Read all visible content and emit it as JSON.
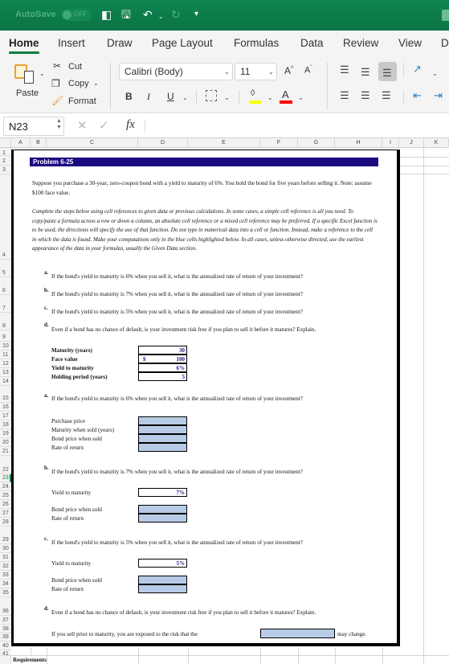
{
  "titlebar": {
    "autosave_label": "AutoSave",
    "autosave_state": "OFF",
    "icons": [
      "sidebar-icon",
      "save-icon",
      "undo-icon",
      "redo-icon",
      "customize-icon"
    ]
  },
  "ribbon": {
    "tabs": [
      {
        "label": "Home",
        "active": true
      },
      {
        "label": "Insert"
      },
      {
        "label": "Draw"
      },
      {
        "label": "Page Layout"
      },
      {
        "label": "Formulas"
      },
      {
        "label": "Data"
      },
      {
        "label": "Review"
      },
      {
        "label": "View"
      },
      {
        "label": "D"
      }
    ],
    "clipboard": {
      "paste": "Paste",
      "cut": "Cut",
      "copy": "Copy",
      "format": "Format"
    },
    "font": {
      "name": "Calibri (Body)",
      "size": "11",
      "bold": "B",
      "italic": "I",
      "underline": "U",
      "grow": "A^",
      "shrink": "Aˇ"
    },
    "colors": {
      "fill": "#ffff00",
      "font": "#ff0000",
      "brand": "#107c41"
    }
  },
  "formula_bar": {
    "name_box": "N23",
    "fx": "fx",
    "value": ""
  },
  "columns": [
    "A",
    "B",
    "C",
    "D",
    "E",
    "F",
    "G",
    "H",
    "I",
    "J",
    "K"
  ],
  "rows": [
    "1",
    "2",
    "3",
    "4",
    "5",
    "6",
    "7",
    "8",
    "9",
    "10",
    "11",
    "12",
    "13",
    "14",
    "15",
    "16",
    "17",
    "18",
    "19",
    "20",
    "21",
    "22",
    "23",
    "24",
    "25",
    "26",
    "27",
    "28",
    "29",
    "30",
    "31",
    "32",
    "33",
    "34",
    "35",
    "36",
    "37",
    "38",
    "39",
    "40",
    "41"
  ],
  "selected_row": "23",
  "sheet": {
    "title": "Problem 6-25",
    "intro": "Suppose you purchase a 30-year, zero-coupon bond with a yield to maturity of 6%. You hold the bond for five years before selling it. Note: assume $100 face value.",
    "instructions": "Complete the steps below using cell references to given data or previous calculations. In some cases, a simple cell reference is all you need. To copy/paste a formula across a row or down a column, an absolute cell reference or a mixed cell reference may be preferred. If a specific Excel function is to be used, the directions will specify the use of that function. Do not type in numerical data into a cell or function. Instead, make a reference to the cell in which the data is found. Make your computations only in the blue cells highlighted below. In all cases, unless otherwise directed, use the earliest appearance of the data in your formulas, usually the Given Data section.",
    "questions": [
      {
        "letter": "a.",
        "text": "If the bond's yield to maturity is 6% when you sell it, what is the annualized rate of return of your investment?"
      },
      {
        "letter": "b.",
        "text": "If the bond's yield to maturity is 7% when you sell it, what is the annualized rate of return of your investment?"
      },
      {
        "letter": "c.",
        "text": "If the bond's yield to maturity is 5% when you sell it, what is the annualized rate of return of your investment?"
      },
      {
        "letter": "d.",
        "text": "Even if a bond has no chance of default, is your investment risk free if you plan to sell it before it matures? Explain."
      }
    ],
    "given": [
      {
        "label": "Maturity (years)",
        "prefix": "",
        "value": "30"
      },
      {
        "label": "Face value",
        "prefix": "$",
        "value": "100"
      },
      {
        "label": "Yield to maturity",
        "prefix": "",
        "value": "6%"
      },
      {
        "label": "Holding period (years)",
        "prefix": "",
        "value": "5"
      }
    ],
    "part_a": {
      "labels": [
        "Purchase price",
        "Maturity when sold (years)",
        "Bond price when sold",
        "Rate of return"
      ]
    },
    "part_b": {
      "ytm_label": "Yield to maturity",
      "ytm_value": "7%",
      "labels": [
        "Bond price when sold",
        "Rate of return"
      ]
    },
    "part_c": {
      "ytm_label": "Yield to maturity",
      "ytm_value": "5%",
      "labels": [
        "Bond price when sold",
        "Rate of return"
      ]
    },
    "part_d": {
      "sentence_start": "If you sell prior to maturity, you are exposed to the risk that the",
      "sentence_end": "may change."
    },
    "requirements": "Requirements",
    "input_fill": "#b7cbe6",
    "banner_color": "#1a0a80"
  }
}
